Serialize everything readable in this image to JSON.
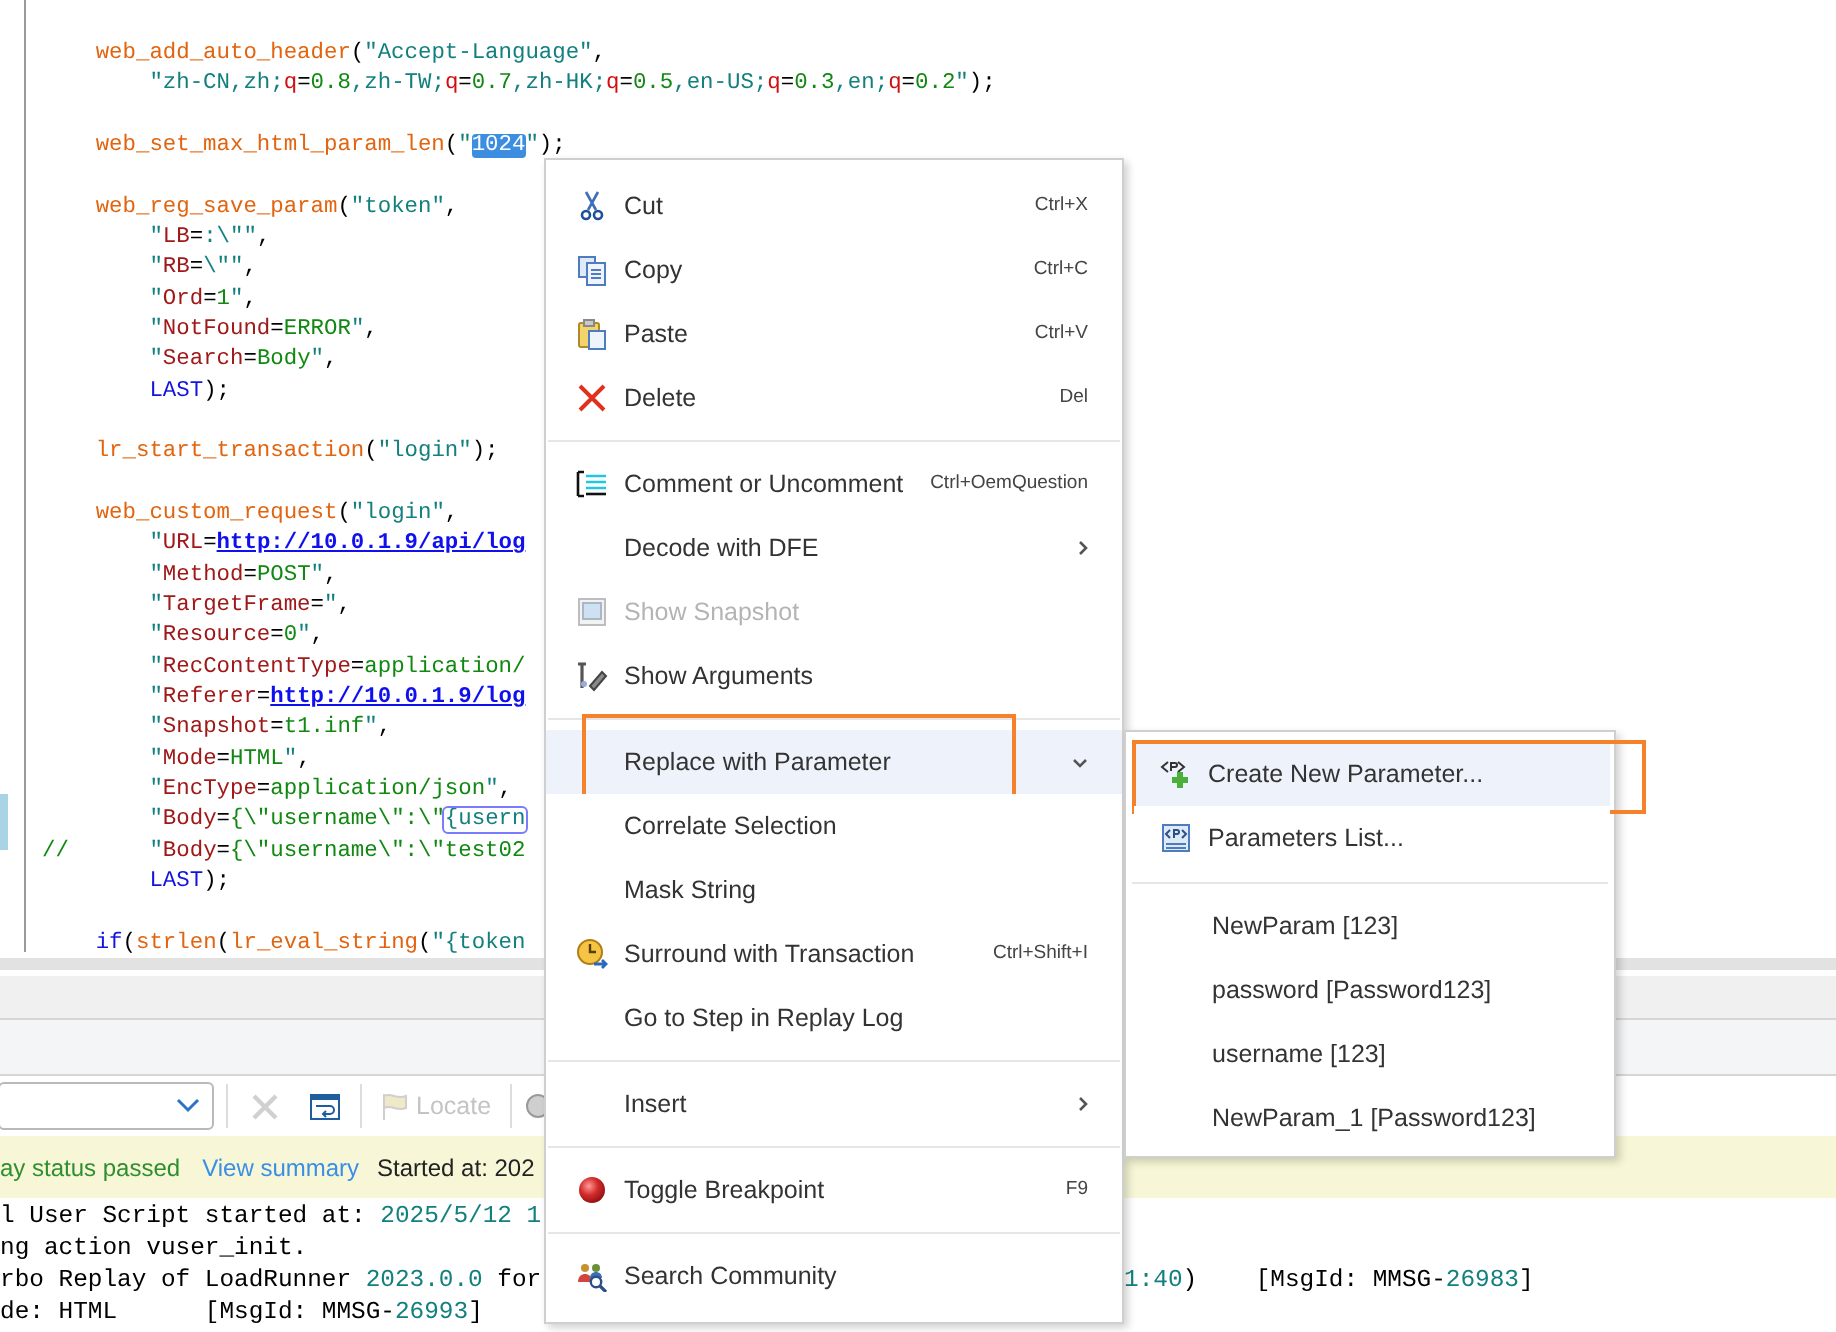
{
  "editor": {
    "lines": [
      {
        "kind": "statement",
        "segments": [
          {
            "text": "web_add_auto_header",
            "kind": "fn"
          },
          {
            "text": "(",
            "kind": "plain"
          },
          {
            "text": "\"Accept-Language\"",
            "kind": "str"
          },
          {
            "text": ",",
            "kind": "plain"
          }
        ]
      },
      {
        "kind": "argument",
        "segments": [
          {
            "text": "\"zh-CN,zh;",
            "kind": "str"
          },
          {
            "text": "q",
            "kind": "op"
          },
          {
            "text": "=",
            "kind": "plain"
          },
          {
            "text": "0.8",
            "kind": "val"
          },
          {
            "text": ",zh-TW;",
            "kind": "str"
          },
          {
            "text": "q",
            "kind": "op"
          },
          {
            "text": "=",
            "kind": "plain"
          },
          {
            "text": "0.7",
            "kind": "val"
          },
          {
            "text": ",zh-HK;",
            "kind": "str"
          },
          {
            "text": "q",
            "kind": "op"
          },
          {
            "text": "=",
            "kind": "plain"
          },
          {
            "text": "0.5",
            "kind": "val"
          },
          {
            "text": ",en-US;",
            "kind": "str"
          },
          {
            "text": "q",
            "kind": "op"
          },
          {
            "text": "=",
            "kind": "plain"
          },
          {
            "text": "0.3",
            "kind": "val"
          },
          {
            "text": ",en;",
            "kind": "str"
          },
          {
            "text": "q",
            "kind": "op"
          },
          {
            "text": "=",
            "kind": "plain"
          },
          {
            "text": "0.2",
            "kind": "val"
          },
          {
            "text": "\"",
            "kind": "str"
          },
          {
            "text": ");",
            "kind": "plain"
          }
        ]
      },
      {
        "kind": "statement",
        "blank_before": true,
        "segments": [
          {
            "text": "web_set_max_html_param_len",
            "kind": "fn"
          },
          {
            "text": "(",
            "kind": "plain"
          },
          {
            "text": "\"",
            "kind": "str"
          },
          {
            "text": "1024",
            "kind": "sel"
          },
          {
            "text": "\"",
            "kind": "str"
          },
          {
            "text": ");",
            "kind": "plain"
          }
        ]
      },
      {
        "kind": "statement",
        "blank_before": true,
        "segments": [
          {
            "text": "web_reg_save_param",
            "kind": "fn"
          },
          {
            "text": "(",
            "kind": "plain"
          },
          {
            "text": "\"token\"",
            "kind": "str"
          },
          {
            "text": ",",
            "kind": "plain"
          }
        ]
      },
      {
        "kind": "argument",
        "segments": [
          {
            "text": "\"",
            "kind": "str"
          },
          {
            "text": "LB",
            "kind": "key"
          },
          {
            "text": "=",
            "kind": "plain"
          },
          {
            "text": ":\\\"\"",
            "kind": "str"
          },
          {
            "text": ",",
            "kind": "plain"
          }
        ]
      },
      {
        "kind": "argument",
        "segments": [
          {
            "text": "\"",
            "kind": "str"
          },
          {
            "text": "RB",
            "kind": "key"
          },
          {
            "text": "=",
            "kind": "plain"
          },
          {
            "text": "\\\"\"",
            "kind": "str"
          },
          {
            "text": ",",
            "kind": "plain"
          }
        ]
      },
      {
        "kind": "argument",
        "segments": [
          {
            "text": "\"",
            "kind": "str"
          },
          {
            "text": "Ord",
            "kind": "key"
          },
          {
            "text": "=",
            "kind": "plain"
          },
          {
            "text": "1",
            "kind": "val"
          },
          {
            "text": "\"",
            "kind": "str"
          },
          {
            "text": ",",
            "kind": "plain"
          }
        ]
      },
      {
        "kind": "argument",
        "segments": [
          {
            "text": "\"",
            "kind": "str"
          },
          {
            "text": "NotFound",
            "kind": "key"
          },
          {
            "text": "=",
            "kind": "plain"
          },
          {
            "text": "ERROR",
            "kind": "val"
          },
          {
            "text": "\"",
            "kind": "str"
          },
          {
            "text": ",",
            "kind": "plain"
          }
        ]
      },
      {
        "kind": "argument",
        "segments": [
          {
            "text": "\"",
            "kind": "str"
          },
          {
            "text": "Search",
            "kind": "key"
          },
          {
            "text": "=",
            "kind": "plain"
          },
          {
            "text": "Body",
            "kind": "val"
          },
          {
            "text": "\"",
            "kind": "str"
          },
          {
            "text": ",",
            "kind": "plain"
          }
        ]
      },
      {
        "kind": "argument",
        "segments": [
          {
            "text": "LAST",
            "kind": "kw"
          },
          {
            "text": ");",
            "kind": "plain"
          }
        ]
      },
      {
        "kind": "statement",
        "blank_before": true,
        "segments": [
          {
            "text": "lr_start_transaction",
            "kind": "fn"
          },
          {
            "text": "(",
            "kind": "plain"
          },
          {
            "text": "\"login\"",
            "kind": "str"
          },
          {
            "text": ");",
            "kind": "plain"
          }
        ]
      },
      {
        "kind": "statement",
        "blank_before": true,
        "segments": [
          {
            "text": "web_custom_request",
            "kind": "fn"
          },
          {
            "text": "(",
            "kind": "plain"
          },
          {
            "text": "\"login\"",
            "kind": "str"
          },
          {
            "text": ",",
            "kind": "plain"
          }
        ]
      },
      {
        "kind": "argument",
        "segments": [
          {
            "text": "\"",
            "kind": "str"
          },
          {
            "text": "URL",
            "kind": "key"
          },
          {
            "text": "=",
            "kind": "plain"
          },
          {
            "text": "http://10.0.1.9/api/log",
            "kind": "url"
          }
        ]
      },
      {
        "kind": "argument",
        "segments": [
          {
            "text": "\"",
            "kind": "str"
          },
          {
            "text": "Method",
            "kind": "key"
          },
          {
            "text": "=",
            "kind": "plain"
          },
          {
            "text": "POST",
            "kind": "val"
          },
          {
            "text": "\"",
            "kind": "str"
          },
          {
            "text": ",",
            "kind": "plain"
          }
        ]
      },
      {
        "kind": "argument",
        "segments": [
          {
            "text": "\"",
            "kind": "str"
          },
          {
            "text": "TargetFrame",
            "kind": "key"
          },
          {
            "text": "=",
            "kind": "plain"
          },
          {
            "text": "\"",
            "kind": "str"
          },
          {
            "text": ",",
            "kind": "plain"
          }
        ]
      },
      {
        "kind": "argument",
        "segments": [
          {
            "text": "\"",
            "kind": "str"
          },
          {
            "text": "Resource",
            "kind": "key"
          },
          {
            "text": "=",
            "kind": "plain"
          },
          {
            "text": "0",
            "kind": "val"
          },
          {
            "text": "\"",
            "kind": "str"
          },
          {
            "text": ",",
            "kind": "plain"
          }
        ]
      },
      {
        "kind": "argument",
        "segments": [
          {
            "text": "\"",
            "kind": "str"
          },
          {
            "text": "RecContentType",
            "kind": "key"
          },
          {
            "text": "=",
            "kind": "plain"
          },
          {
            "text": "application/",
            "kind": "val"
          }
        ]
      },
      {
        "kind": "argument",
        "segments": [
          {
            "text": "\"",
            "kind": "str"
          },
          {
            "text": "Referer",
            "kind": "key"
          },
          {
            "text": "=",
            "kind": "plain"
          },
          {
            "text": "http://10.0.1.9/log",
            "kind": "url"
          }
        ]
      },
      {
        "kind": "argument",
        "segments": [
          {
            "text": "\"",
            "kind": "str"
          },
          {
            "text": "Snapshot",
            "kind": "key"
          },
          {
            "text": "=",
            "kind": "plain"
          },
          {
            "text": "t1.inf",
            "kind": "val"
          },
          {
            "text": "\"",
            "kind": "str"
          },
          {
            "text": ",",
            "kind": "plain"
          }
        ]
      },
      {
        "kind": "argument",
        "segments": [
          {
            "text": "\"",
            "kind": "str"
          },
          {
            "text": "Mode",
            "kind": "key"
          },
          {
            "text": "=",
            "kind": "plain"
          },
          {
            "text": "HTML",
            "kind": "val"
          },
          {
            "text": "\"",
            "kind": "str"
          },
          {
            "text": ",",
            "kind": "plain"
          }
        ]
      },
      {
        "kind": "argument",
        "segments": [
          {
            "text": "\"",
            "kind": "str"
          },
          {
            "text": "EncType",
            "kind": "key"
          },
          {
            "text": "=",
            "kind": "plain"
          },
          {
            "text": "application/json",
            "kind": "val"
          },
          {
            "text": "\"",
            "kind": "str"
          },
          {
            "text": ",",
            "kind": "plain"
          }
        ]
      },
      {
        "kind": "argument",
        "segments": [
          {
            "text": "\"",
            "kind": "str"
          },
          {
            "text": "Body",
            "kind": "key"
          },
          {
            "text": "=",
            "kind": "plain"
          },
          {
            "text": "{\\\"username\\\":\\\"",
            "kind": "val"
          },
          {
            "text": "{usern",
            "kind": "box"
          }
        ]
      },
      {
        "kind": "commented",
        "segments": [
          {
            "text": "//",
            "kind": "comment"
          },
          {
            "text": "\"",
            "kind": "str"
          },
          {
            "text": "Body",
            "kind": "key"
          },
          {
            "text": "=",
            "kind": "plain"
          },
          {
            "text": "{\\\"username\\\":\\\"test02",
            "kind": "val"
          }
        ]
      },
      {
        "kind": "argument",
        "segments": [
          {
            "text": "LAST",
            "kind": "kw"
          },
          {
            "text": ");",
            "kind": "plain"
          }
        ]
      },
      {
        "kind": "statement",
        "blank_before": true,
        "segments": [
          {
            "text": "if",
            "kind": "kw"
          },
          {
            "text": "(",
            "kind": "plain"
          },
          {
            "text": "strlen",
            "kind": "fn"
          },
          {
            "text": "(",
            "kind": "plain"
          },
          {
            "text": "lr_eval_string",
            "kind": "fn"
          },
          {
            "text": "(",
            "kind": "plain"
          },
          {
            "text": "\"{token",
            "kind": "str"
          }
        ]
      }
    ]
  },
  "context_menu": {
    "groups": [
      [
        {
          "label": "Cut",
          "shortcut": "Ctrl+X",
          "kind": "command",
          "disabled": false,
          "selected": false,
          "annotated": false
        },
        {
          "label": "Copy",
          "shortcut": "Ctrl+C",
          "kind": "command",
          "disabled": false,
          "selected": false,
          "annotated": false
        },
        {
          "label": "Paste",
          "shortcut": "Ctrl+V",
          "kind": "command",
          "disabled": false,
          "selected": false,
          "annotated": false
        },
        {
          "label": "Delete",
          "shortcut": "Del",
          "kind": "command",
          "disabled": false,
          "selected": false,
          "annotated": false
        }
      ],
      [
        {
          "label": "Comment or Uncomment",
          "shortcut": "Ctrl+OemQuestion",
          "kind": "command",
          "disabled": false,
          "selected": false,
          "annotated": false
        },
        {
          "label": "Decode with DFE",
          "kind": "submenu",
          "expanded": false,
          "disabled": false,
          "selected": false,
          "annotated": false
        },
        {
          "label": "Show Snapshot",
          "kind": "command",
          "disabled": true,
          "selected": false,
          "annotated": false
        },
        {
          "label": "Show Arguments",
          "kind": "command",
          "disabled": false,
          "selected": false,
          "annotated": false
        }
      ],
      [
        {
          "label": "Replace with Parameter",
          "kind": "submenu",
          "expanded": true,
          "disabled": false,
          "selected": true,
          "annotated": true
        },
        {
          "label": "Correlate Selection",
          "kind": "command",
          "disabled": false,
          "selected": false,
          "annotated": false
        },
        {
          "label": "Mask String",
          "kind": "command",
          "disabled": false,
          "selected": false,
          "annotated": false
        },
        {
          "label": "Surround with Transaction",
          "shortcut": "Ctrl+Shift+I",
          "kind": "command",
          "disabled": false,
          "selected": false,
          "annotated": false
        },
        {
          "label": "Go to Step in Replay Log",
          "kind": "command",
          "disabled": false,
          "selected": false,
          "annotated": false
        }
      ],
      [
        {
          "label": "Insert",
          "kind": "submenu",
          "expanded": false,
          "disabled": false,
          "selected": false,
          "annotated": false
        }
      ],
      [
        {
          "label": "Toggle Breakpoint",
          "shortcut": "F9",
          "kind": "command",
          "disabled": false,
          "selected": false,
          "annotated": false
        }
      ],
      [
        {
          "label": "Search Community",
          "kind": "command",
          "disabled": false,
          "selected": false,
          "annotated": false
        }
      ]
    ]
  },
  "submenu": {
    "actions": [
      {
        "label": "Create New Parameter...",
        "selected": true,
        "annotated": true
      },
      {
        "label": "Parameters List...",
        "selected": false,
        "annotated": false
      }
    ],
    "parameters": [
      {
        "label": "NewParam [123]",
        "selected": false
      },
      {
        "label": "password [Password123]",
        "selected": false
      },
      {
        "label": "username [123]",
        "selected": false
      },
      {
        "label": "NewParam_1 [Password123]",
        "selected": false
      }
    ]
  },
  "output_panel": {
    "toolbar": {
      "locate": {
        "label": "Locate",
        "disabled": true
      }
    },
    "status_bar": {
      "result": "ay status passed",
      "link": "View summary",
      "started": "Started at: 202"
    },
    "log": [
      {
        "segments": [
          {
            "text": "l User Script started at: ",
            "kind": "plain"
          },
          {
            "text": "2025/5/12 1",
            "kind": "num"
          }
        ]
      },
      {
        "segments": [
          {
            "text": "ng action vuser_init.",
            "kind": "plain"
          }
        ]
      },
      {
        "segments": [
          {
            "text": "rbo Replay of LoadRunner ",
            "kind": "plain"
          },
          {
            "text": "2023.0.0",
            "kind": "num"
          },
          {
            "text": " for",
            "kind": "plain"
          }
        ],
        "right_segments": [
          {
            "text": "1:40",
            "kind": "num"
          },
          {
            "text": ")    [MsgId: MMSG-",
            "kind": "plain"
          },
          {
            "text": "26983",
            "kind": "num"
          },
          {
            "text": "]",
            "kind": "plain"
          }
        ]
      },
      {
        "segments": [
          {
            "text": "de: HTML      [MsgId: MMSG-",
            "kind": "plain"
          },
          {
            "text": "26993",
            "kind": "num"
          },
          {
            "text": "]",
            "kind": "plain"
          }
        ]
      }
    ]
  }
}
